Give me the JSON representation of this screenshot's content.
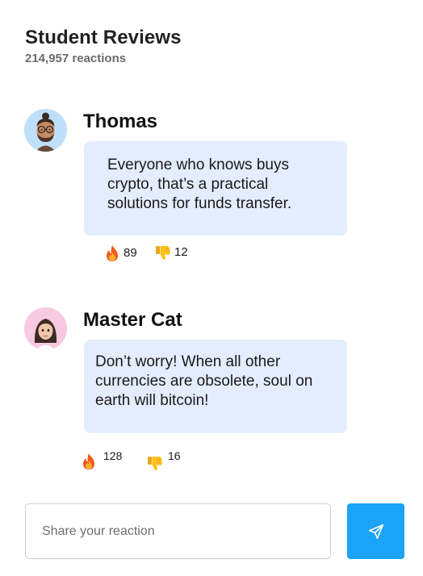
{
  "header": {
    "title": "Student Reviews",
    "reactions_count": "214,957 reactions"
  },
  "reviews": [
    {
      "author": "Thomas",
      "avatar_icon": "memoji-man-glasses-icon",
      "avatar_bg": "#bfe0fb",
      "message": "Everyone who knows buys crypto, that’s a practical solutions for funds transfer.",
      "fire_count": "89",
      "thumbs_down_count": "12"
    },
    {
      "author": "Master Cat",
      "avatar_icon": "memoji-woman-icon",
      "avatar_bg": "#f7c9e2",
      "message": "Don’t worry! When all other currencies are obsolete, soul on earth will bitcoin!",
      "fire_count": "128",
      "thumbs_down_count": "16"
    }
  ],
  "composer": {
    "placeholder": "Share your reaction",
    "send_icon": "send-icon"
  },
  "colors": {
    "bubble": "#e3edfe",
    "send_button": "#1aa3f7",
    "subtitle": "#6b6b6b"
  }
}
